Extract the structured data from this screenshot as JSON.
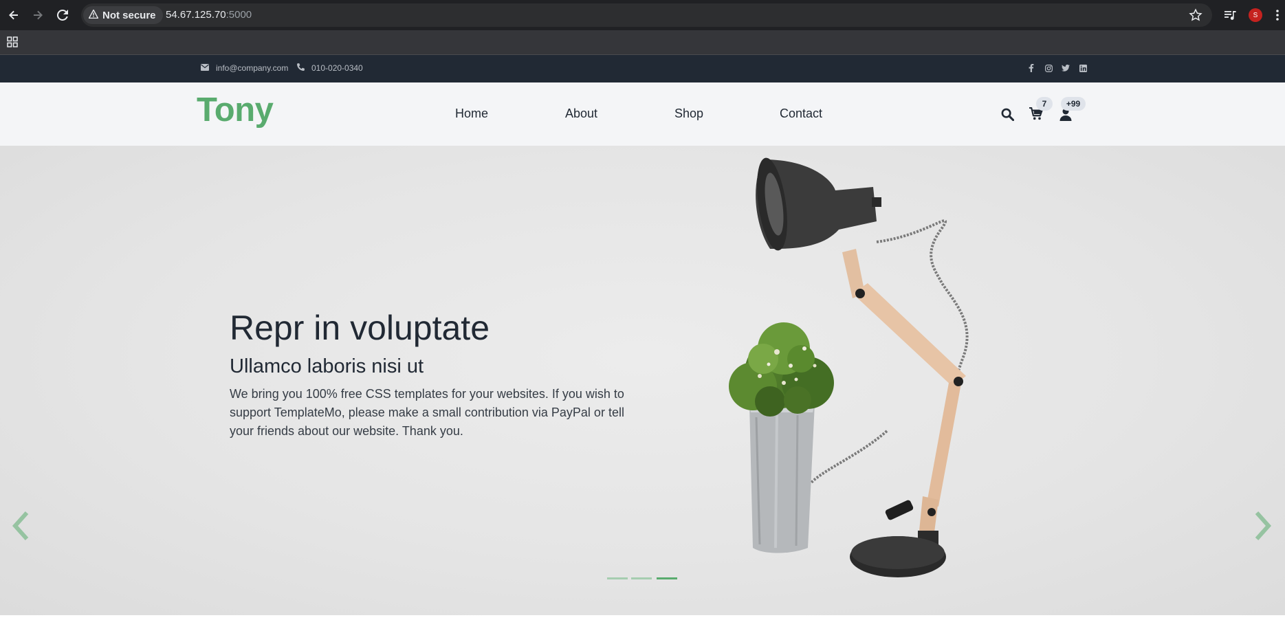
{
  "browser": {
    "security_label": "Not secure",
    "url_host": "54.67.125.70",
    "url_port": ":5000",
    "profile_initial": "S",
    "icons": [
      "back-icon",
      "forward-icon",
      "reload-icon",
      "warning-icon",
      "star-icon",
      "media-icon",
      "menu-icon",
      "apps-icon"
    ]
  },
  "topbar": {
    "email": "info@company.com",
    "phone": "010-020-0340",
    "social": [
      "facebook-icon",
      "instagram-icon",
      "twitter-icon",
      "linkedin-icon"
    ]
  },
  "header": {
    "brand": "Tony",
    "menu": [
      "Home",
      "About",
      "Shop",
      "Contact"
    ],
    "cart_count": "7",
    "user_count": "+99"
  },
  "hero": {
    "title": "Repr in voluptate",
    "subtitle": "Ullamco laboris nisi ut",
    "text": "We bring you 100% free CSS templates for your websites. If you wish to support TemplateMo, please make a small contribution via PayPal or tell your friends about our website. Thank you.",
    "slides_total": 3,
    "active_slide": 3
  },
  "colors": {
    "brand": "#59ab6e",
    "topbar_bg": "#212934",
    "header_bg": "#f4f5f7",
    "text_dark": "#212934"
  }
}
